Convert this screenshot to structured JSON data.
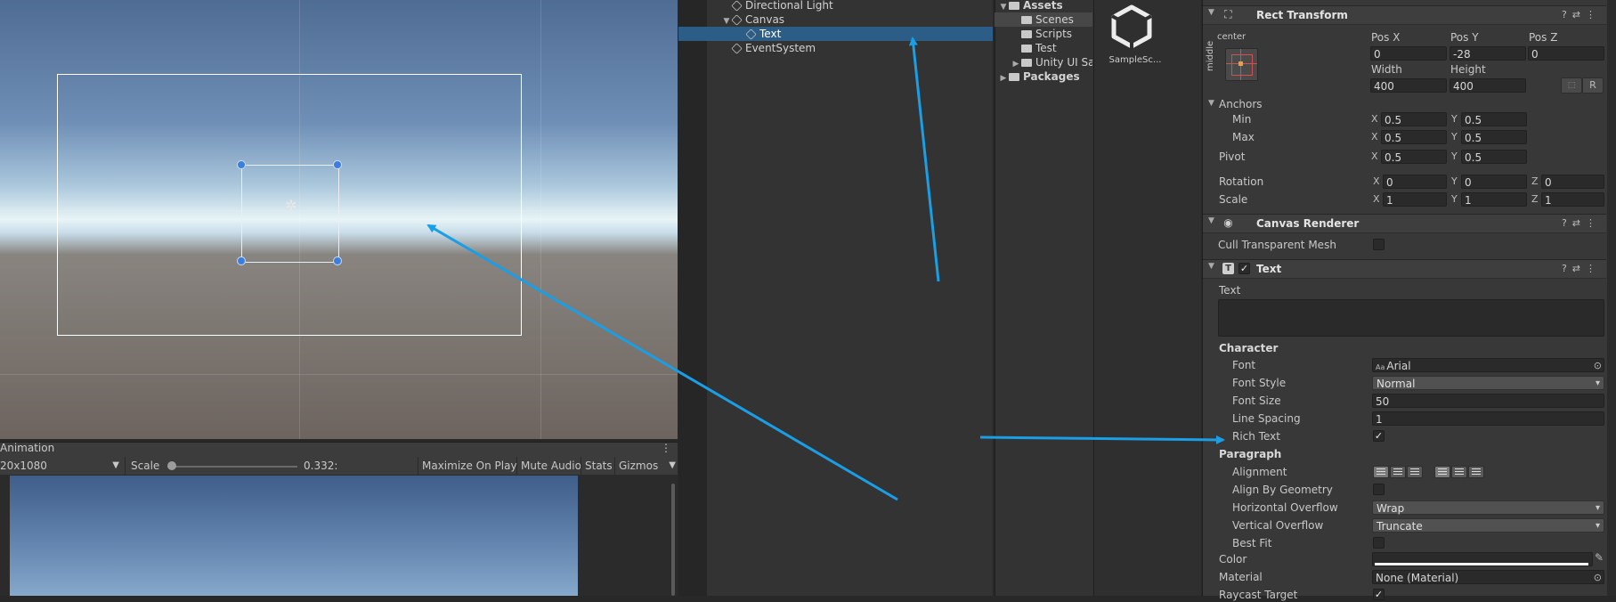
{
  "hierarchy": {
    "items": [
      {
        "label": "Directional Light",
        "depth": 1,
        "selected": false
      },
      {
        "label": "Canvas",
        "depth": 1,
        "selected": false,
        "expanded": true
      },
      {
        "label": "Text",
        "depth": 2,
        "selected": true
      },
      {
        "label": "EventSystem",
        "depth": 1,
        "selected": false
      }
    ]
  },
  "project": {
    "tree": [
      {
        "label": "Assets",
        "bold": true
      },
      {
        "label": "Scenes"
      },
      {
        "label": "Scripts"
      },
      {
        "label": "Test"
      },
      {
        "label": "Unity UI Sa"
      },
      {
        "label": "Packages",
        "bold": true
      }
    ],
    "files": [
      {
        "label": "SampleSc..."
      }
    ]
  },
  "game": {
    "tab": "Animation",
    "resolution": "20x1080",
    "scale_label": "Scale",
    "scale_value": "0.332:",
    "buttons": [
      "Maximize On Play",
      "Mute Audio",
      "Stats",
      "Gizmos"
    ]
  },
  "inspector": {
    "rect_transform": {
      "title": "Rect Transform",
      "anchor_preset_top": "center",
      "anchor_preset_side": "middle",
      "pos_x_label": "Pos X",
      "pos_y_label": "Pos Y",
      "pos_z_label": "Pos Z",
      "pos_x": "0",
      "pos_y": "-28",
      "pos_z": "0",
      "width_label": "Width",
      "height_label": "Height",
      "width": "400",
      "height": "400",
      "raw_button": "R",
      "anchors_label": "Anchors",
      "min_label": "Min",
      "max_label": "Max",
      "anchor_min_x": "0.5",
      "anchor_min_y": "0.5",
      "anchor_max_x": "0.5",
      "anchor_max_y": "0.5",
      "pivot_label": "Pivot",
      "pivot_x": "0.5",
      "pivot_y": "0.5",
      "rotation_label": "Rotation",
      "rot_x": "0",
      "rot_y": "0",
      "rot_z": "0",
      "scale_label": "Scale",
      "scale_x": "1",
      "scale_y": "1",
      "scale_z": "1",
      "axis_x": "X",
      "axis_y": "Y",
      "axis_z": "Z"
    },
    "canvas_renderer": {
      "title": "Canvas Renderer",
      "cull_label": "Cull Transparent Mesh",
      "cull_checked": false
    },
    "text": {
      "title": "Text",
      "text_label": "Text",
      "text_value": "",
      "character_label": "Character",
      "font_label": "Font",
      "font_value": "Arial",
      "font_prefix": "Aa",
      "font_style_label": "Font Style",
      "font_style_value": "Normal",
      "font_size_label": "Font Size",
      "font_size_value": "50",
      "line_spacing_label": "Line Spacing",
      "line_spacing_value": "1",
      "rich_text_label": "Rich Text",
      "rich_text_checked": true,
      "paragraph_label": "Paragraph",
      "alignment_label": "Alignment",
      "align_geometry_label": "Align By Geometry",
      "align_geometry_checked": false,
      "h_overflow_label": "Horizontal Overflow",
      "h_overflow_value": "Wrap",
      "v_overflow_label": "Vertical Overflow",
      "v_overflow_value": "Truncate",
      "best_fit_label": "Best Fit",
      "best_fit_checked": false,
      "color_label": "Color",
      "color_value": "#ffffff",
      "material_label": "Material",
      "material_value": "None (Material)",
      "raycast_label": "Raycast Target",
      "raycast_checked": true
    }
  },
  "colors": {
    "selection": "#2c5d87",
    "annotation_arrow": "#1a9ee6",
    "handle": "#3c7de0"
  }
}
